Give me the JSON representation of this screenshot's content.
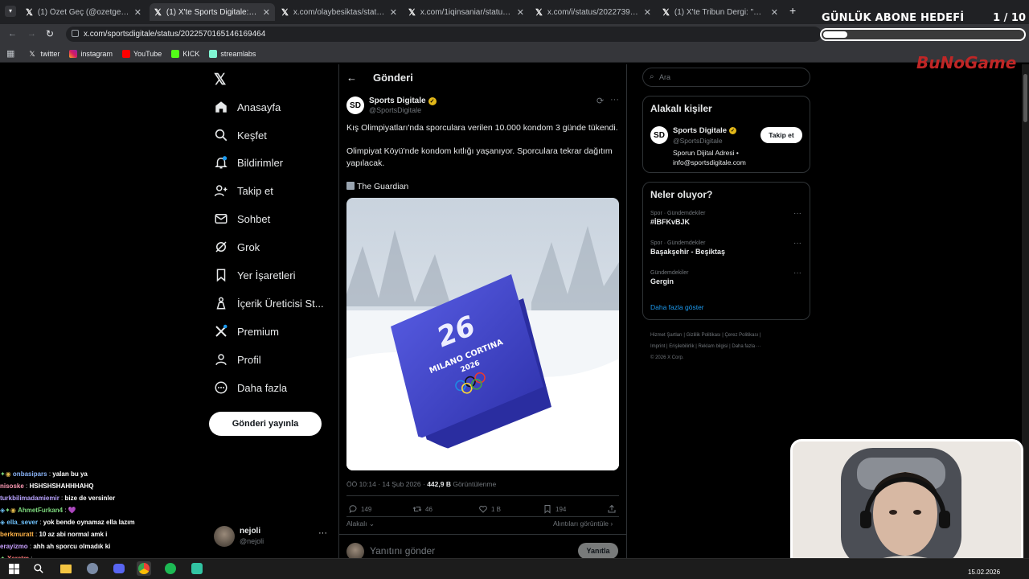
{
  "browser": {
    "tabs": [
      {
        "label": "(1) Özet Geç (@ozetgechaber) /",
        "active": false
      },
      {
        "label": "(1) X'te Sports Digitale: \"Kış Oli",
        "active": true
      },
      {
        "label": "x.com/olaybesiktas/status/2022",
        "active": false
      },
      {
        "label": "x.com/1iqinsaniar/status/20225",
        "active": false
      },
      {
        "label": "x.com/i/status/2022739740240",
        "active": false
      },
      {
        "label": "(1) X'te Tribun Dergi: \"Şimdi so",
        "active": false
      }
    ],
    "url": "x.com/sportsdigitale/status/2022570165146169464",
    "bookmarks": [
      "twitter",
      "instagram",
      "YouTube",
      "KICK",
      "streamlabs"
    ]
  },
  "overlay": {
    "goal_title": "GÜNLÜK ABONE HEDEFİ",
    "goal_count": "1 / 10",
    "goal_fraction": 0.1,
    "brand": "BuNoGame"
  },
  "nav": {
    "items": [
      "Anasayfa",
      "Keşfet",
      "Bildirimler",
      "Takip et",
      "Sohbet",
      "Grok",
      "Yer İşaretleri",
      "İçerik Üreticisi St...",
      "Premium",
      "Profil",
      "Daha fazla"
    ],
    "post_button": "Gönderi yayınla",
    "user_name": "nejoli",
    "user_handle": "@nejoli"
  },
  "chat": [
    {
      "user": "onbasipars",
      "msg": "yalan bu ya",
      "color": "#8ab4f8"
    },
    {
      "user": "nisoske",
      "msg": "HSHSHSHAHHHAHQ",
      "color": "#ff9ab5"
    },
    {
      "user": "turkbilimadamiemir",
      "msg": "bize de versinler",
      "color": "#b9a3ff"
    },
    {
      "user": "AhmetFurkan4",
      "msg": "",
      "color": "#7dd87d"
    },
    {
      "user": "ella_sever",
      "msg": "yok bende oynamaz ella lazım",
      "color": "#6fc3ff"
    },
    {
      "user": "berkmuratt",
      "msg": "10 az abi normal amk i",
      "color": "#ffb347"
    },
    {
      "user": "erayizmo",
      "msg": "ahh ah sporcu olmadık ki",
      "color": "#c9a0ff"
    },
    {
      "user": "Xaratm",
      "msg": "",
      "color": "#ff7a7a"
    }
  ],
  "post": {
    "header": "Gönderi",
    "author_name": "Sports Digitale",
    "author_handle": "@SportsDigitale",
    "paragraph1": "Kış Olimpiyatları'nda sporculara verilen 10.000 kondom 3 günde tükendi.",
    "paragraph2": "Olimpiyat Köyü'nde kondom kıtlığı yaşanıyor. Sporculara tekrar dağıtım yapılacak.",
    "source": "The Guardian",
    "media_text_line1": "MILANO CORTINA",
    "media_text_line2": "2026",
    "time": "ÖÖ 10:14 · 14 Şub 2026 ·",
    "views": "442,9 B",
    "views_label": "Görüntülenme",
    "replies": "149",
    "reposts": "46",
    "likes": "1 B",
    "bookmarks": "194",
    "relevant": "Alakalı",
    "quotes": "Alıntıları görüntüle ›",
    "reply_placeholder": "Yanıtını gönder",
    "reply_button": "Yanıtla"
  },
  "right": {
    "search_placeholder": "Ara",
    "relevant_title": "Alakalı kişiler",
    "person_name": "Sports Digitale",
    "person_handle": "@SportsDigitale",
    "person_bio": "Sporun Dijital Adresi • info@sportsdigitale.com",
    "follow_label": "Takip et",
    "trends_title": "Neler oluyor?",
    "trends": [
      {
        "context": "Spor · Gündemdekiler",
        "name": "#İBFKvBJK"
      },
      {
        "context": "Spor · Gündemdekiler",
        "name": "Başakşehir - Beşiktaş"
      },
      {
        "context": "Gündemdekiler",
        "name": "Gergin"
      }
    ],
    "show_more": "Daha fazla göster",
    "footer_line1": "Hizmet Şartları | Gizlilik Politikası | Çerez Politikası |",
    "footer_line2": "Imprint | Erişilebilirlik | Reklam bilgisi | Daha fazla ···",
    "footer_line3": "© 2026 X Corp."
  },
  "taskbar": {
    "date": "15.02.2026"
  },
  "colors": {
    "accent": "#1d9bf0",
    "verified": "#e2b719",
    "media_blue": "#3a3fc4"
  }
}
